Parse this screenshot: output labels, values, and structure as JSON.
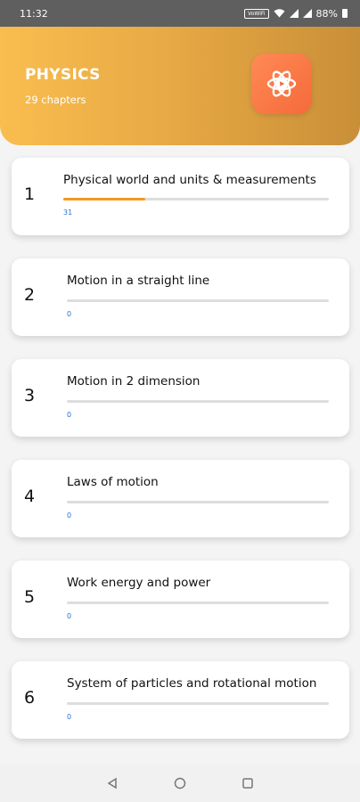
{
  "status": {
    "time": "11:32",
    "vowifi": "VoWiFi",
    "battery": "88%"
  },
  "header": {
    "title": "PHYSICS",
    "subtitle": "29 chapters",
    "icon": "atom-play-icon"
  },
  "colors": {
    "header_start": "#f9bd4f",
    "header_end": "#c98f38",
    "progress": "#f39a1f",
    "percent_text": "#2a6fd6",
    "icon_bg": "#f56a3a"
  },
  "chapters": [
    {
      "number": "1",
      "title": "Physical world and units & measurements",
      "progress": 31,
      "progress_label": "31"
    },
    {
      "number": "2",
      "title": "Motion in a straight line",
      "progress": 0,
      "progress_label": "0"
    },
    {
      "number": "3",
      "title": "Motion in 2 dimension",
      "progress": 0,
      "progress_label": "0"
    },
    {
      "number": "4",
      "title": "Laws of motion",
      "progress": 0,
      "progress_label": "0"
    },
    {
      "number": "5",
      "title": "Work energy and power",
      "progress": 0,
      "progress_label": "0"
    },
    {
      "number": "6",
      "title": "System of particles and rotational motion",
      "progress": 0,
      "progress_label": "0"
    }
  ],
  "nav": {
    "back_icon": "back-triangle-icon",
    "home_icon": "home-circle-icon",
    "recents_icon": "recents-square-icon"
  }
}
